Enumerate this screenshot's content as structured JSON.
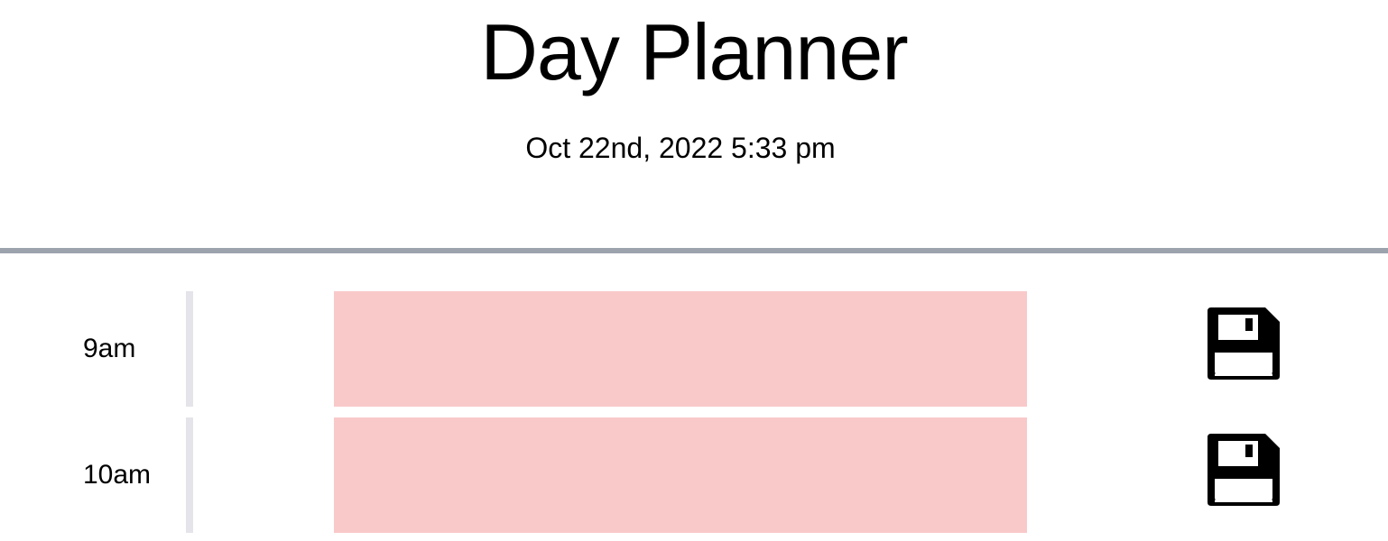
{
  "header": {
    "title": "Day Planner",
    "current_datetime": "Oct 22nd, 2022 5:33 pm"
  },
  "timeblocks": [
    {
      "hour_label": "9am",
      "description": "",
      "status": "past",
      "save_icon": "floppy-disk-icon"
    },
    {
      "hour_label": "10am",
      "description": "",
      "status": "past",
      "save_icon": "floppy-disk-icon"
    }
  ],
  "colors": {
    "past_block": "#f9c9ca",
    "divider": "#9da3ad",
    "hour_border": "#e4e4ea"
  }
}
